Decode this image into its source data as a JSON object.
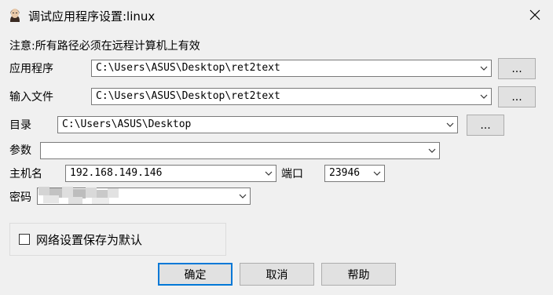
{
  "window": {
    "title": "调试应用程序设置:linux"
  },
  "notice": "注意:所有路径必须在远程计算机上有效",
  "fields": {
    "application": {
      "label": "应用程序",
      "value": "C:\\Users\\ASUS\\Desktop\\ret2text",
      "browse": "..."
    },
    "input_file": {
      "label": "输入文件",
      "value": "C:\\Users\\ASUS\\Desktop\\ret2text",
      "browse": "..."
    },
    "directory": {
      "label": "目录",
      "value": "C:\\Users\\ASUS\\Desktop",
      "browse": "..."
    },
    "params": {
      "label": "参数",
      "value": ""
    },
    "hostname": {
      "label": "主机名",
      "value": "192.168.149.146"
    },
    "port": {
      "label": "端口",
      "value": "23946"
    },
    "password": {
      "label": "密码",
      "value": ""
    }
  },
  "save_default": {
    "label": "网络设置保存为默认",
    "checked": false
  },
  "buttons": {
    "ok": "确定",
    "cancel": "取消",
    "help": "帮助"
  },
  "colors": {
    "accent": "#0078d7",
    "background": "#f0f0f0"
  },
  "icons": {
    "app": "app-avatar-icon",
    "close": "close-icon",
    "dropdown": "chevron-down-icon",
    "checkbox": "checkbox-icon"
  }
}
